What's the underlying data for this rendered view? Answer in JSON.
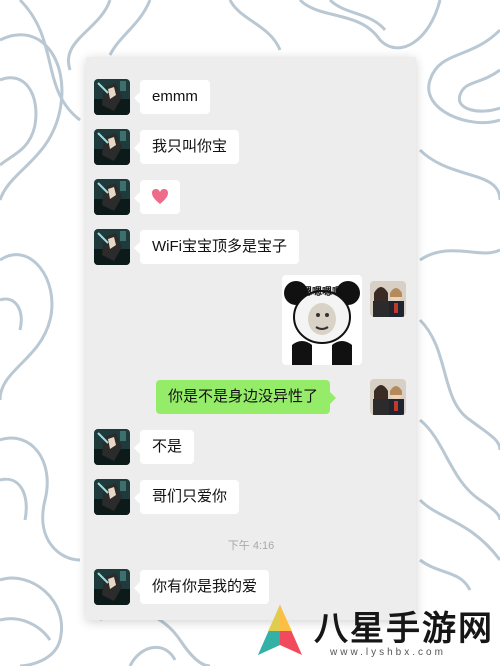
{
  "conversation": {
    "messages": [
      {
        "sender": "friend",
        "text": "emmm"
      },
      {
        "sender": "friend",
        "text": "我只叫你宝"
      },
      {
        "sender": "friend",
        "type": "emoji",
        "emoji": "heart"
      },
      {
        "sender": "friend",
        "text": "WiFi宝宝顶多是宝子"
      },
      {
        "sender": "me",
        "type": "sticker",
        "sticker": "panda-meme",
        "caption": "嗯嗯嗯嗯"
      },
      {
        "sender": "me",
        "text": "你是不是身边没异性了"
      },
      {
        "sender": "friend",
        "text": "不是"
      },
      {
        "sender": "friend",
        "text": "哥们只爱你"
      },
      {
        "sender": "friend",
        "text": "你有你是我的爱"
      }
    ],
    "timestamp": "下午 4:16"
  },
  "watermark": {
    "title": "八星手游网",
    "url": "www.lyshbx.com"
  },
  "colors": {
    "outgoing_bubble": "#95ec69",
    "incoming_bubble": "#ffffff",
    "chat_background": "#ededed",
    "background_lines": "#b9c8d3"
  }
}
